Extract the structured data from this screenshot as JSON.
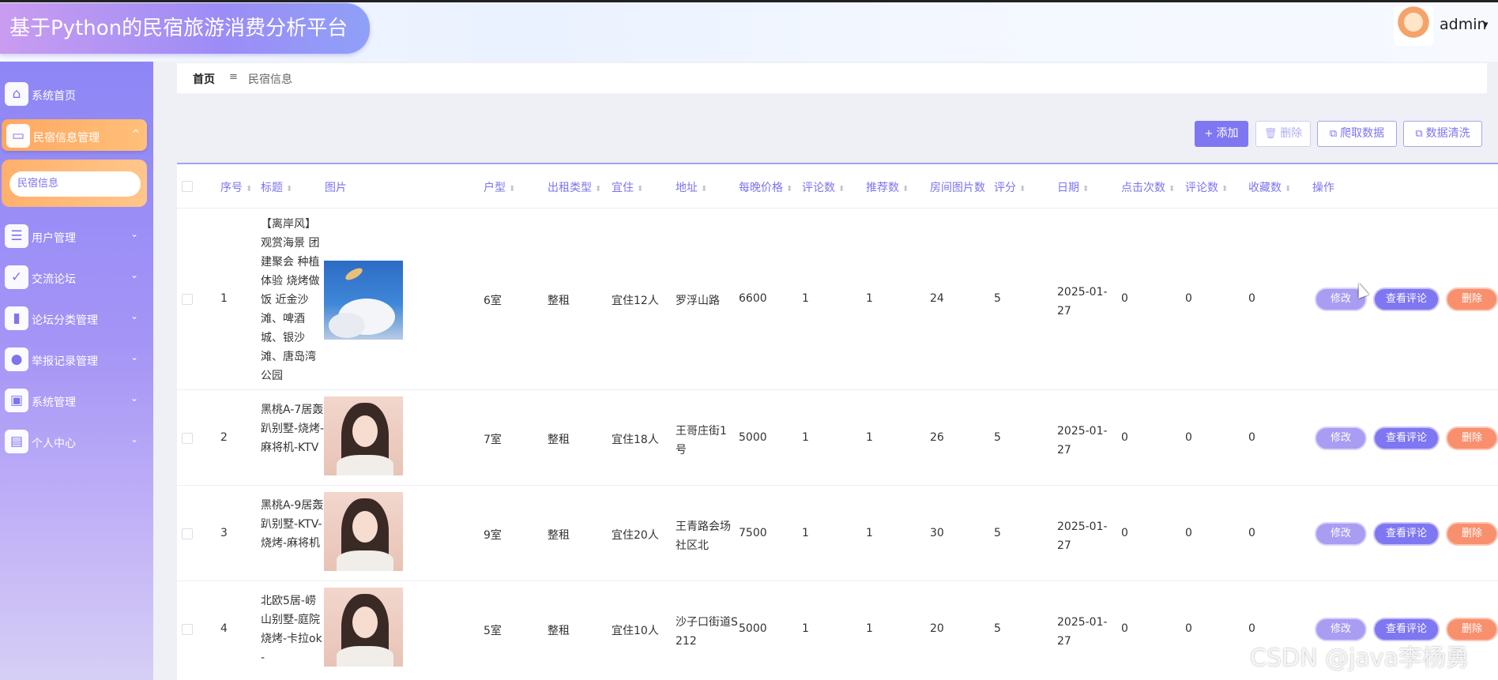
{
  "app": {
    "title": "基于Python的民宿旅游消费分析平台"
  },
  "user": {
    "name": "admin",
    "caret": "▾"
  },
  "sidebar": {
    "items": [
      {
        "label": "系统首页",
        "icon": "home-icon",
        "glyph": "⌂"
      },
      {
        "label": "民宿信息管理",
        "icon": "monitor-icon",
        "glyph": "▭",
        "expanded": true,
        "chevron": "^"
      },
      {
        "label": "用户管理",
        "icon": "sliders-icon",
        "glyph": "☰",
        "chevron": "⌄"
      },
      {
        "label": "交流论坛",
        "icon": "clipboard-icon",
        "glyph": "✓",
        "chevron": "⌄"
      },
      {
        "label": "论坛分类管理",
        "icon": "book-icon",
        "glyph": "▮",
        "chevron": "⌄"
      },
      {
        "label": "举报记录管理",
        "icon": "bulb-icon",
        "glyph": "●",
        "chevron": "⌄"
      },
      {
        "label": "系统管理",
        "icon": "briefcase-icon",
        "glyph": "▣",
        "chevron": "⌄"
      },
      {
        "label": "个人中心",
        "icon": "wallet-icon",
        "glyph": "▤",
        "chevron": "⌄"
      }
    ],
    "submenu": {
      "label": "民宿信息"
    }
  },
  "breadcrumb": {
    "home": "首页",
    "sep": "≡",
    "current": "民宿信息"
  },
  "toolbar": {
    "add": "添加",
    "add_icon": "+",
    "delete": "删除",
    "crawl": "爬取数据",
    "clean": "数据清洗"
  },
  "table": {
    "headers": [
      "序号",
      "标题",
      "图片",
      "户型",
      "出租类型",
      "宜住",
      "地址",
      "每晚价格",
      "评论数",
      "推荐数",
      "房间图片数",
      "评分",
      "日期",
      "点击次数",
      "评论数",
      "收藏数",
      "操作"
    ],
    "sort_glyph": "⬍",
    "rows": [
      {
        "no": "1",
        "title": "【离岸风】观赏海景 团建聚会 种植体验 烧烤做饭 近金沙滩、啤酒城、银沙滩、唐岛湾公园",
        "photo": "sky",
        "layout": "6室",
        "rent_type": "整租",
        "capacity": "宜住12人",
        "address": "罗浮山路",
        "price": "6600",
        "comments": "1",
        "recommends": "1",
        "room_photos": "24",
        "score": "5",
        "date": "2025-01-27",
        "clicks": "0",
        "comments2": "0",
        "favorites": "0"
      },
      {
        "no": "2",
        "title": "黑桃A-7居轰趴别墅-烧烤-麻将机-KTV",
        "photo": "girl",
        "layout": "7室",
        "rent_type": "整租",
        "capacity": "宜住18人",
        "address": "王哥庄街1号",
        "price": "5000",
        "comments": "1",
        "recommends": "1",
        "room_photos": "26",
        "score": "5",
        "date": "2025-01-27",
        "clicks": "0",
        "comments2": "0",
        "favorites": "0"
      },
      {
        "no": "3",
        "title": "黑桃A-9居轰趴别墅-KTV-烧烤-麻将机",
        "photo": "girl",
        "layout": "9室",
        "rent_type": "整租",
        "capacity": "宜住20人",
        "address": "王青路会场社区北",
        "price": "7500",
        "comments": "1",
        "recommends": "1",
        "room_photos": "30",
        "score": "5",
        "date": "2025-01-27",
        "clicks": "0",
        "comments2": "0",
        "favorites": "0"
      },
      {
        "no": "4",
        "title": "北欧5居-崂山别墅-庭院烧烤-卡拉ok-",
        "photo": "girl",
        "layout": "5室",
        "rent_type": "整租",
        "capacity": "宜住10人",
        "address": "沙子口街道S212",
        "price": "5000",
        "comments": "1",
        "recommends": "1",
        "room_photos": "20",
        "score": "5",
        "date": "2025-01-27",
        "clicks": "0",
        "comments2": "0",
        "favorites": "0"
      }
    ],
    "actions": {
      "edit": "修改",
      "review": "查看评论",
      "delete": "删除"
    }
  },
  "watermark": "CSDN @java李杨勇",
  "colors": {
    "accent": "#7f76f2",
    "orange": "#ffa761",
    "danger": "#f8906e"
  }
}
